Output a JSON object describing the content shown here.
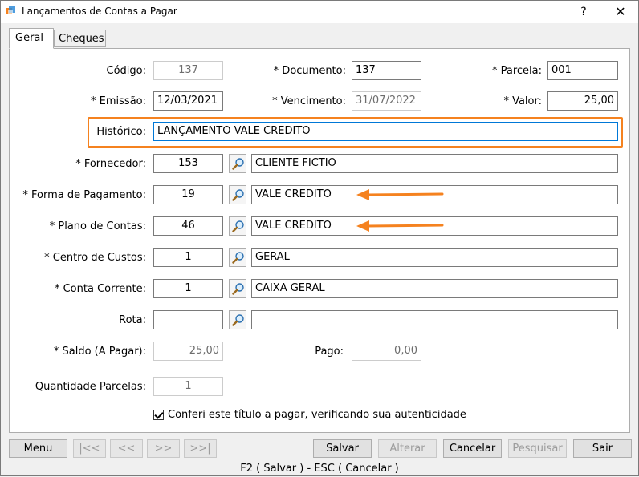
{
  "window": {
    "title": "Lançamentos de Contas a Pagar",
    "help": "?",
    "close": "✕"
  },
  "tabs": [
    {
      "label": "Geral"
    },
    {
      "label": "Cheques"
    }
  ],
  "form": {
    "codigo": {
      "label": "Código:",
      "value": "137"
    },
    "documento": {
      "label": "* Documento:",
      "value": "137"
    },
    "parcela": {
      "label": "* Parcela:",
      "value": "001"
    },
    "emissao": {
      "label": "* Emissão:",
      "value": "12/03/2021"
    },
    "vencimento": {
      "label": "* Vencimento:",
      "value": "31/07/2022"
    },
    "valor": {
      "label": "* Valor:",
      "value": "25,00"
    },
    "historico": {
      "label": "Histórico:",
      "value": "LANÇAMENTO VALE CREDITO"
    },
    "fornecedor": {
      "label": "* Fornecedor:",
      "code": "153",
      "desc": "CLIENTE FICTIO"
    },
    "forma_pagamento": {
      "label": "* Forma de Pagamento:",
      "code": "19",
      "desc": "VALE CREDITO"
    },
    "plano_contas": {
      "label": "* Plano de Contas:",
      "code": "46",
      "desc": "VALE CREDITO"
    },
    "centro_custos": {
      "label": "* Centro de Custos:",
      "code": "1",
      "desc": "GERAL"
    },
    "conta_corrente": {
      "label": "* Conta Corrente:",
      "code": "1",
      "desc": "CAIXA GERAL"
    },
    "rota": {
      "label": "Rota:",
      "code": "",
      "desc": ""
    },
    "saldo": {
      "label": "* Saldo (A Pagar):",
      "value": "25,00"
    },
    "pago": {
      "label": "Pago:",
      "value": "0,00"
    },
    "quantidade_parcelas": {
      "label": "Quantidade Parcelas:",
      "value": "1"
    },
    "conferi": {
      "label": "Conferi este título a pagar, verificando sua autenticidade",
      "checked": true
    }
  },
  "buttons": {
    "menu": "Menu",
    "first": "|<<",
    "prev": "<<",
    "next": ">>",
    "last": ">>|",
    "salvar": "Salvar",
    "alterar": "Alterar",
    "cancelar": "Cancelar",
    "pesquisar": "Pesquisar",
    "sair": "Sair"
  },
  "status_bar": "F2 ( Salvar )  -  ESC ( Cancelar )",
  "colors": {
    "highlight": "#f5821f",
    "focus": "#0078d7"
  }
}
